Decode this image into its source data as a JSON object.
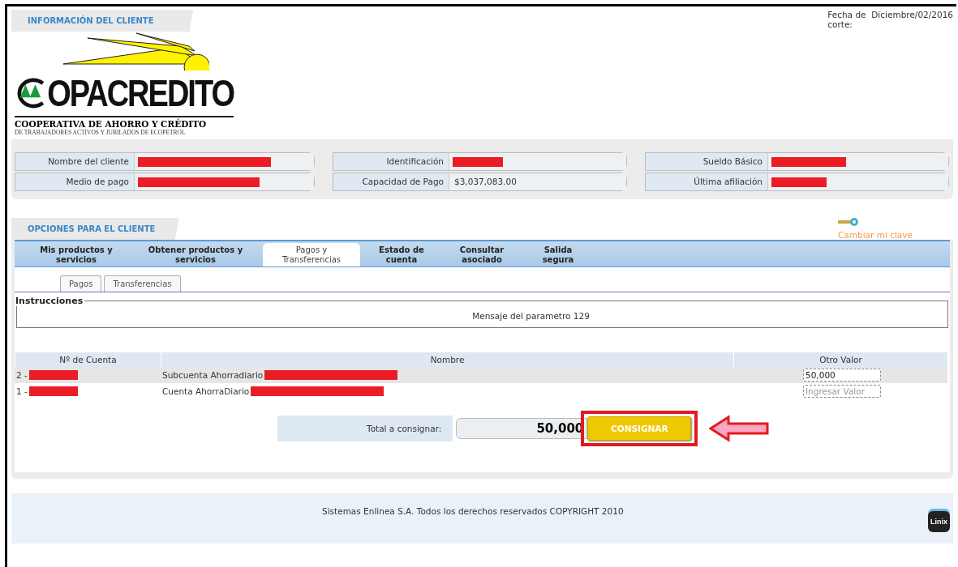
{
  "header": {
    "section_title": "INFORMACIÓN DEL CLIENTE",
    "cutoff_label": "Fecha de corte:",
    "cutoff_value": "Diciembre/02/2016"
  },
  "logo": {
    "wordmark": "OPACREDITO",
    "line_1": "COOPERATIVA DE AHORRO Y CRÉDITO",
    "line_2": "DE TRABAJADORES ACTIVOS Y JUBILADOS DE ECOPETROL"
  },
  "client_fields": [
    {
      "label": "Nombre del cliente",
      "redacted": true
    },
    {
      "label": "Identificación",
      "redacted": true
    },
    {
      "label": "Sueldo Básico",
      "redacted": true
    },
    {
      "label": "Medio de pago",
      "redacted": true
    },
    {
      "label": "Capacidad de Pago",
      "value": "$3,037,083.00",
      "redacted": false
    },
    {
      "label": "Última afiliación",
      "redacted": true
    }
  ],
  "options": {
    "section_title": "OPCIONES PARA EL CLIENTE",
    "change_password_link": "Cambiar mi clave"
  },
  "tabs": [
    {
      "label": "Mis productos y servicios",
      "selected": false
    },
    {
      "label": "Obtener productos y servicios",
      "selected": false
    },
    {
      "label": "Pagos y Transferencias",
      "selected": true
    },
    {
      "label": "Estado de cuenta",
      "selected": false
    },
    {
      "label": "Consultar asociado",
      "selected": false
    },
    {
      "label": "Salida segura",
      "selected": false
    }
  ],
  "subtabs": [
    {
      "label": "Pagos"
    },
    {
      "label": "Transferencias"
    }
  ],
  "instructions": {
    "legend": "Instrucciones",
    "message": "Mensaje del parametro 129"
  },
  "table": {
    "columns": [
      "Nº de Cuenta",
      "Nombre",
      "Otro Valor"
    ],
    "rows": [
      {
        "account": "2 -",
        "name": "Subcuenta Ahorradiario",
        "redacted": true,
        "value": "50,000",
        "selected": true
      },
      {
        "account": "1 -",
        "name": "Cuenta AhorraDiario",
        "redacted": true,
        "placeholder": "Ingresar Valor",
        "selected": false
      }
    ]
  },
  "total": {
    "label": "Total a consignar:",
    "value": "50,000",
    "button": "CONSIGNAR"
  },
  "footer": {
    "text": "Sistemas Enlinea S.A. Todos los derechos reservados COPYRIGHT 2010",
    "logo_text": "Linix"
  }
}
